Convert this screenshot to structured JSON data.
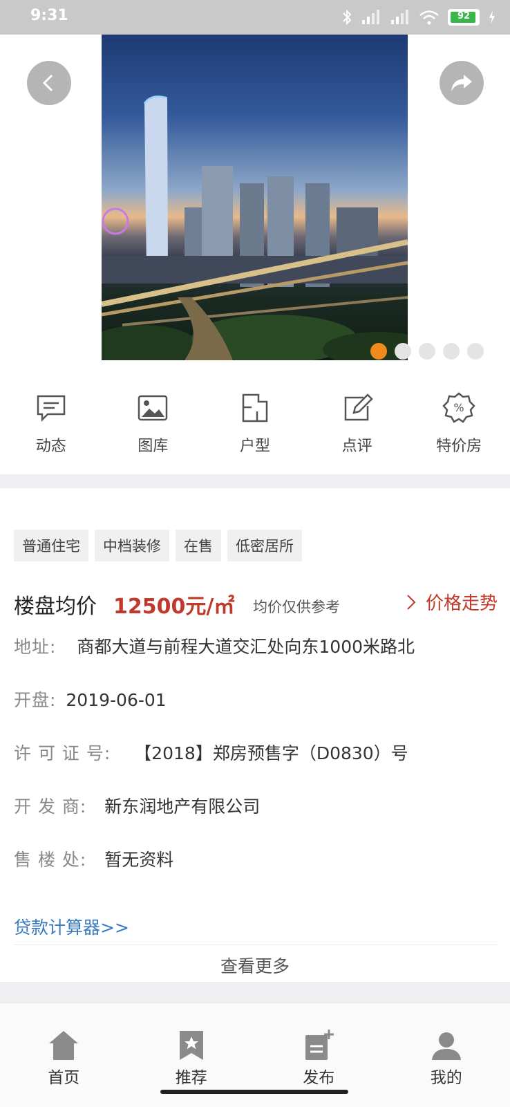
{
  "status_bar": {
    "time": "9:31",
    "battery": "92"
  },
  "hero": {
    "dots_count": 5,
    "active_dot": 0
  },
  "functions": [
    {
      "label": "动态",
      "icon": "message-icon"
    },
    {
      "label": "图库",
      "icon": "gallery-icon"
    },
    {
      "label": "户型",
      "icon": "floorplan-icon"
    },
    {
      "label": "点评",
      "icon": "review-icon"
    },
    {
      "label": "特价房",
      "icon": "discount-icon"
    }
  ],
  "tags": [
    "普通住宅",
    "中档装修",
    "在售",
    "低密居所"
  ],
  "price": {
    "label": "楼盘均价",
    "value": "12500元/㎡",
    "note": "均价仅供参考",
    "trend": "价格走势"
  },
  "info": {
    "address": {
      "label": "地址:",
      "value": "商都大道与前程大道交汇处向东1000米路北"
    },
    "opening": {
      "label": "开盘:",
      "value": "2019-06-01"
    },
    "license": {
      "label": "许 可 证 号:",
      "value": "【2018】郑房预售字（D0830）号"
    },
    "developer": {
      "label": "开 发 商:",
      "value": "新东润地产有限公司"
    },
    "sales_office": {
      "label": "售 楼 处:",
      "value": "暂无资料"
    }
  },
  "loan_calculator": "贷款计算器>>",
  "view_more": "查看更多",
  "bottom_nav": [
    {
      "label": "首页",
      "icon": "home-icon"
    },
    {
      "label": "推荐",
      "icon": "bookmark-star-icon"
    },
    {
      "label": "发布",
      "icon": "publish-icon"
    },
    {
      "label": "我的",
      "icon": "user-icon"
    }
  ],
  "colors": {
    "accent_price": "#c0392b",
    "link": "#3a7bbf",
    "active_dot": "#f08a1c"
  }
}
